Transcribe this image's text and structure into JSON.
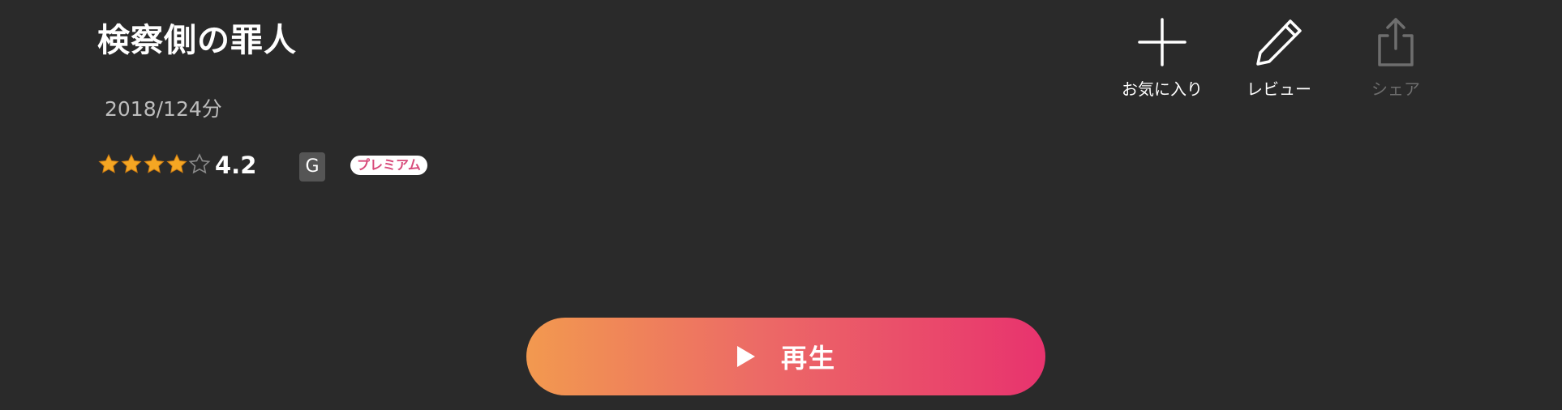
{
  "title": "検察側の罪人",
  "meta": "2018/124分",
  "rating": {
    "value": "4.2",
    "score": 4.2,
    "max_stars": 5,
    "star_color": "#f5a623",
    "empty_star_color": "#8a8a8a"
  },
  "badges": {
    "age_rating": "G",
    "premium": "プレミアム",
    "premium_color": "#d84a7a"
  },
  "actions": {
    "favorite": {
      "label": "お気に入り",
      "icon": "plus-icon",
      "enabled": true
    },
    "review": {
      "label": "レビュー",
      "icon": "pencil-icon",
      "enabled": true
    },
    "share": {
      "label": "シェア",
      "icon": "share-icon",
      "enabled": false
    }
  },
  "play": {
    "label": "再生",
    "icon": "play-icon",
    "gradient": [
      "#f2994f",
      "#e8336e"
    ]
  },
  "colors": {
    "background": "#2a2a2a",
    "text": "#ffffff",
    "muted_text": "#bdbdbd",
    "disabled": "#6e6e6e"
  }
}
